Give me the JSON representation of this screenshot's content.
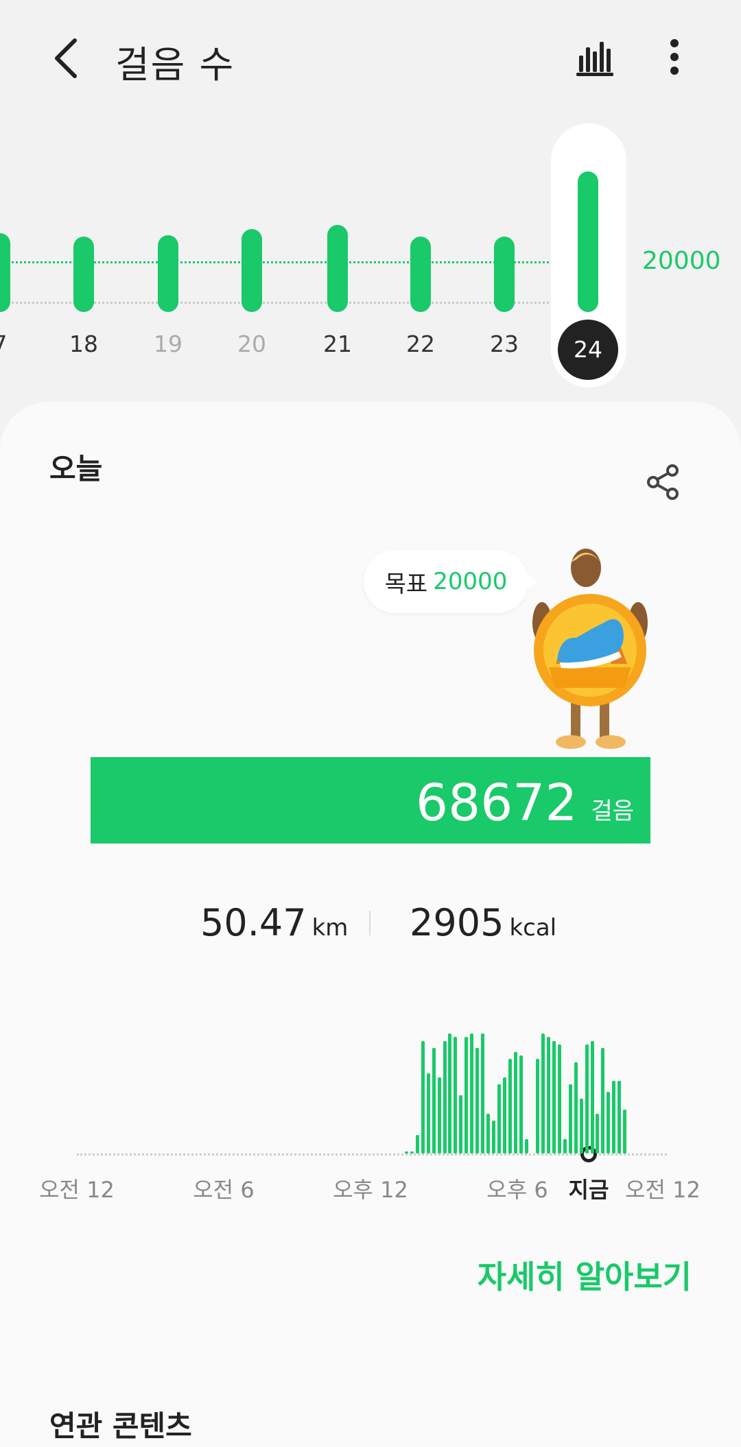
{
  "header": {
    "title": "걸음 수"
  },
  "week_chart": {
    "goal": "20000",
    "days": [
      {
        "label": "7",
        "value": 19500,
        "style": "normal"
      },
      {
        "label": "18",
        "value": 16000,
        "style": "normal"
      },
      {
        "label": "19",
        "value": 19000,
        "style": "dim"
      },
      {
        "label": "20",
        "value": 20500,
        "style": "dim"
      },
      {
        "label": "21",
        "value": 21500,
        "style": "normal"
      },
      {
        "label": "22",
        "value": 16500,
        "style": "normal"
      },
      {
        "label": "23",
        "value": 16800,
        "style": "normal"
      },
      {
        "label": "24",
        "value": 68672,
        "style": "selected"
      }
    ]
  },
  "today": {
    "label": "오늘",
    "goal_label": "목표",
    "goal_value": "20000",
    "steps_value": "68672",
    "steps_unit": "걸음",
    "distance_value": "50.47",
    "distance_unit": "km",
    "calories_value": "2905",
    "calories_unit": "kcal"
  },
  "hourly_chart": {
    "labels": [
      "오전 12",
      "오전 6",
      "오후 12",
      "오후 6",
      "지금",
      "오전 12"
    ],
    "values": [
      0,
      0,
      0,
      0,
      0,
      0,
      0,
      0,
      0,
      0,
      0,
      0,
      0,
      0,
      0,
      0,
      0,
      0,
      0,
      0,
      0,
      0,
      0,
      0,
      0,
      0,
      0,
      0,
      0,
      0,
      0,
      0,
      0,
      0,
      0,
      0,
      0,
      0,
      0,
      0,
      0,
      0,
      0,
      0,
      0,
      0,
      0,
      0,
      0,
      0,
      0,
      0,
      0,
      0,
      0,
      0,
      0,
      0,
      0,
      0,
      1,
      1,
      25,
      155,
      110,
      145,
      105,
      155,
      165,
      160,
      80,
      160,
      165,
      145,
      165,
      55,
      45,
      95,
      105,
      130,
      140,
      135,
      20,
      0,
      130,
      165,
      160,
      155,
      150,
      20,
      95,
      125,
      75,
      150,
      155,
      55,
      145,
      85,
      100,
      100,
      60,
      0,
      0,
      0,
      0,
      0,
      0,
      0
    ]
  },
  "links": {
    "learn_more": "자세히 알아보기",
    "related": "연관 콘텐츠"
  },
  "colors": {
    "accent": "#1ac969",
    "background": "#f2f2f2",
    "card": "#fafafa"
  }
}
